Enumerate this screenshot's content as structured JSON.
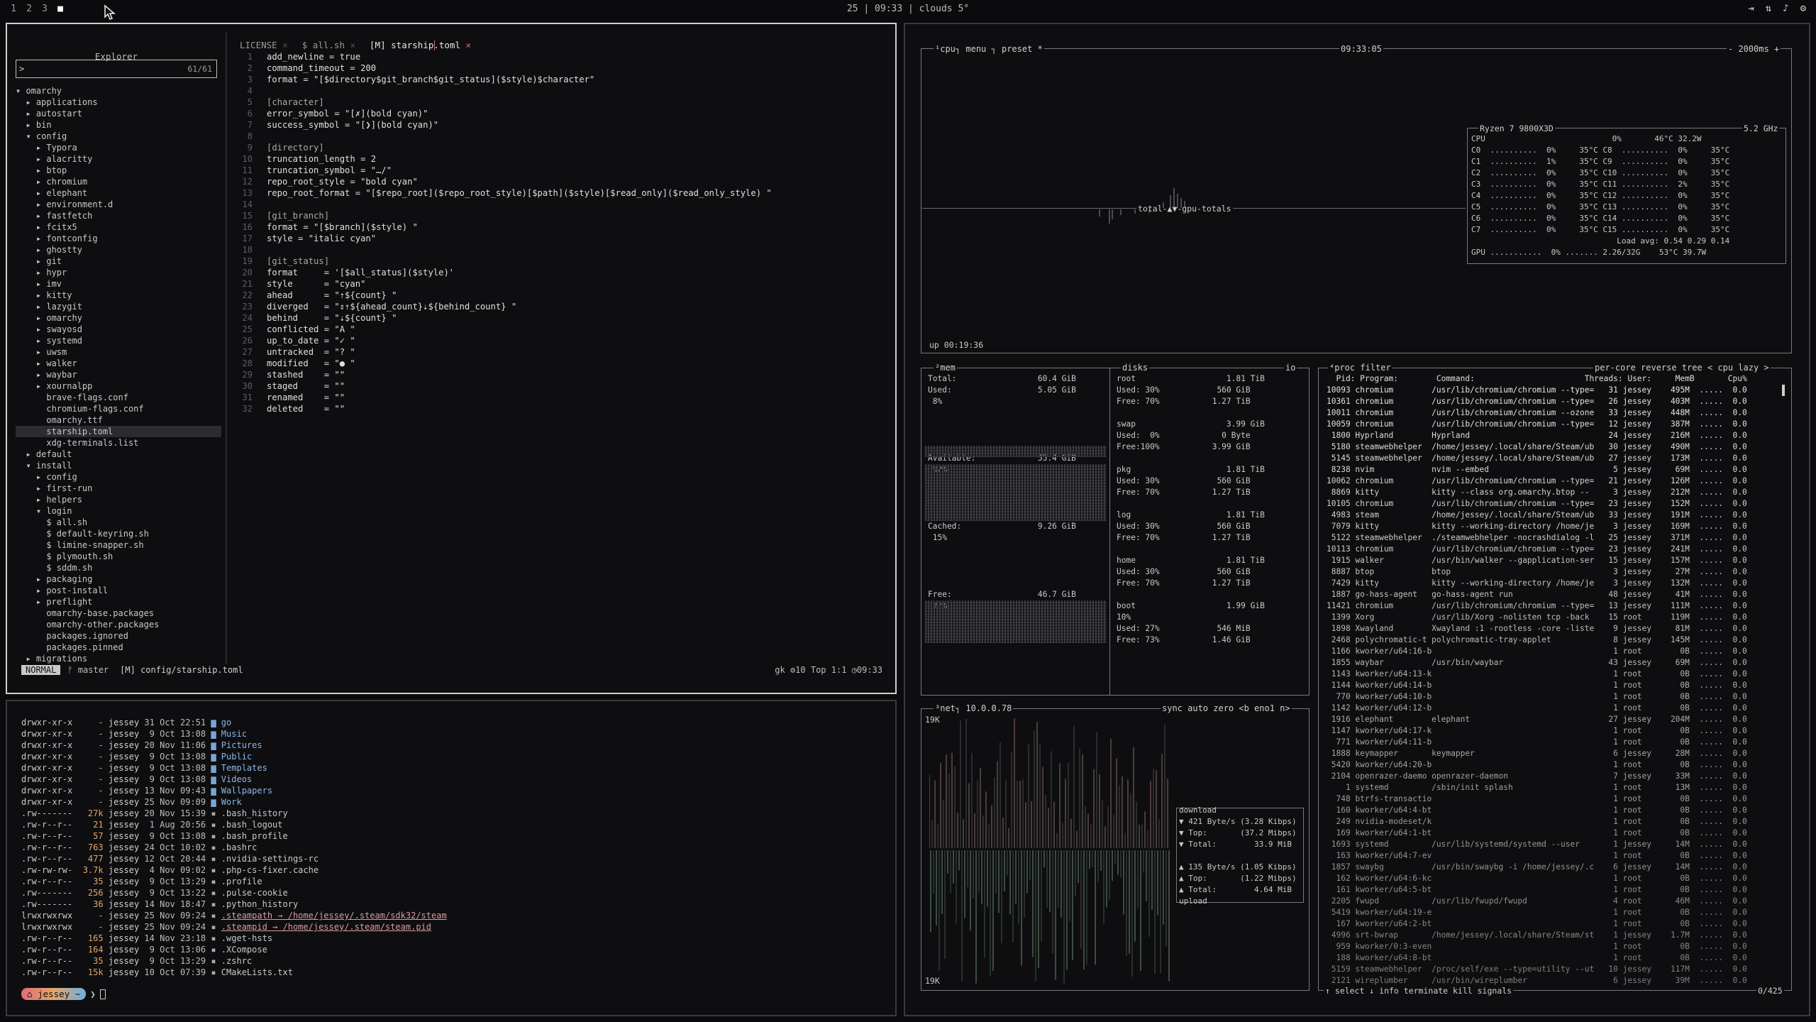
{
  "topbar": {
    "workspaces": [
      "1",
      "2",
      "3",
      "■"
    ],
    "center": "25 | 09:33 | clouds 5°",
    "tray_icons": [
      "logout-icon",
      "network-icon",
      "volume-icon",
      "settings-icon"
    ]
  },
  "explorer": {
    "title": "Explorer",
    "count": "61/61",
    "prompt": ">",
    "tree": [
      "▾ omarchy",
      "  ▸ applications",
      "  ▸ autostart",
      "  ▸ bin",
      "  ▾ config",
      "    ▸ Typora",
      "    ▸ alacritty",
      "    ▸ btop",
      "    ▸ chromium",
      "    ▸ elephant",
      "    ▸ environment.d",
      "    ▸ fastfetch",
      "    ▸ fcitx5",
      "    ▸ fontconfig",
      "    ▸ ghostty",
      "    ▸ git",
      "    ▸ hypr",
      "    ▸ imv",
      "    ▸ kitty",
      "    ▸ lazygit",
      "    ▸ omarchy",
      "    ▸ swayosd",
      "    ▸ systemd",
      "    ▸ uwsm",
      "    ▸ walker",
      "    ▸ waybar",
      "    ▸ xournalpp",
      "      brave-flags.conf",
      "      chromium-flags.conf",
      "      omarchy.ttf",
      "      starship.toml",
      "      xdg-terminals.list",
      "  ▸ default",
      "  ▾ install",
      "    ▸ config",
      "    ▸ first-run",
      "    ▸ helpers",
      "    ▾ login",
      "      $ all.sh",
      "      $ default-keyring.sh",
      "      $ limine-snapper.sh",
      "      $ plymouth.sh",
      "      $ sddm.sh",
      "    ▸ packaging",
      "    ▸ post-install",
      "    ▸ preflight",
      "      omarchy-base.packages",
      "      omarchy-other.packages",
      "      packages.ignored",
      "      packages.pinned",
      "  ▸ migrations"
    ],
    "selected_index": 30
  },
  "editor": {
    "tabs": [
      "LICENSE",
      "$ all.sh",
      "starship.toml"
    ],
    "lines": [
      "add_newline = true",
      "command_timeout = 200",
      "format = \"[$directory$git_branch$git_status]($style)$character\"",
      "",
      "[character]",
      "error_symbol = \"[✗](bold cyan)\"",
      "success_symbol = \"[❯](bold cyan)\"",
      "",
      "[directory]",
      "truncation_length = 2",
      "truncation_symbol = \"…/\"",
      "repo_root_style = \"bold cyan\"",
      "repo_root_format = \"[$repo_root]($repo_root_style)[$path]($style)[$read_only]($read_only_style) \"",
      "",
      "[git_branch]",
      "format = \"[$branch]($style) \"",
      "style = \"italic cyan\"",
      "",
      "[git_status]",
      "format     = '[$all_status]($style)'",
      "style      = \"cyan\"",
      "ahead      = \"⇡${count} \"",
      "diverged   = \"⇕⇡${ahead_count}⇣${behind_count} \"",
      "behind     = \"⇣${count} \"",
      "conflicted = \"A \"",
      "up_to_date = \"✓ \"",
      "untracked  = \"? \"",
      "modified   = \"● \"",
      "stashed    = \"\"",
      "staged     = \"\"",
      "renamed    = \"\"",
      "deleted    = \"\""
    ],
    "status": {
      "mode": "NORMAL",
      "branch": "master",
      "file": "config/starship.toml",
      "right": "gk  ⚙10   Top   1:1   ◷09:33"
    }
  },
  "terminal": {
    "rows": [
      [
        "drwxr-xr-x",
        "-",
        "jessey",
        "31 Oct 22:51",
        "go"
      ],
      [
        "drwxr-xr-x",
        "-",
        "jessey",
        " 9 Oct 13:08",
        "Music"
      ],
      [
        "drwxr-xr-x",
        "-",
        "jessey",
        "20 Nov 11:06",
        "Pictures"
      ],
      [
        "drwxr-xr-x",
        "-",
        "jessey",
        " 9 Oct 13:08",
        "Public"
      ],
      [
        "drwxr-xr-x",
        "-",
        "jessey",
        " 9 Oct 13:08",
        "Templates"
      ],
      [
        "drwxr-xr-x",
        "-",
        "jessey",
        " 9 Oct 13:08",
        "Videos"
      ],
      [
        "drwxr-xr-x",
        "-",
        "jessey",
        "13 Nov 09:43",
        "Wallpapers"
      ],
      [
        "drwxr-xr-x",
        "-",
        "jessey",
        "25 Nov 09:09",
        "Work"
      ],
      [
        ".rw-------",
        "27k",
        "jessey",
        "20 Nov 15:39",
        ".bash_history"
      ],
      [
        ".rw-r--r--",
        "21",
        "jessey",
        " 1 Aug 20:56",
        ".bash_logout"
      ],
      [
        ".rw-r--r--",
        "57",
        "jessey",
        " 9 Oct 13:08",
        ".bash_profile"
      ],
      [
        ".rw-r--r--",
        "763",
        "jessey",
        "24 Oct 10:02",
        ".bashrc"
      ],
      [
        ".rw-r--r--",
        "477",
        "jessey",
        "12 Oct 20:44",
        ".nvidia-settings-rc"
      ],
      [
        ".rw-rw-rw-",
        "3.7k",
        "jessey",
        " 4 Nov 09:02",
        ".php-cs-fixer.cache"
      ],
      [
        ".rw-r--r--",
        "35",
        "jessey",
        " 9 Oct 13:29",
        ".profile"
      ],
      [
        ".rw-------",
        "256",
        "jessey",
        " 9 Oct 13:22",
        ".pulse-cookie"
      ],
      [
        ".rw-------",
        "36",
        "jessey",
        "14 Nov 18:47",
        ".python_history"
      ],
      [
        "lrwxrwxrwx",
        "-",
        "jessey",
        "25 Nov 09:24",
        ".steampath → /home/jessey/.steam/sdk32/steam"
      ],
      [
        "lrwxrwxrwx",
        "-",
        "jessey",
        "25 Nov 09:24",
        ".steampid → /home/jessey/.steam/steam.pid"
      ],
      [
        ".rw-r--r--",
        "165",
        "jessey",
        "14 Nov 23:18",
        ".wget-hsts"
      ],
      [
        ".rw-r--r--",
        "164",
        "jessey",
        " 9 Oct 13:06",
        ".XCompose"
      ],
      [
        ".rw-r--r--",
        "35",
        "jessey",
        " 9 Oct 13:29",
        ".zshrc"
      ],
      [
        ".rw-r--r--",
        "15k",
        "jessey",
        "10 Oct 07:39",
        "CMakeLists.txt"
      ]
    ],
    "prompt_user": "jessey",
    "prompt_symbol": "❯"
  },
  "btop": {
    "cpu_header": [
      "cpu",
      "menu",
      "preset *",
      "09:33:05",
      "- 2000ms +"
    ],
    "graph_label": "total-▲▼-gpu-totals",
    "uptime": "up 00:19:36",
    "cpu_box": {
      "model": "Ryzen 7 9800X3D",
      "freq": "5.2 GHz",
      "cpu_row": "CPU                           0%       46°C 32.2W",
      "cores": [
        "C0  ..........  0%     35°C C8  ..........  0%     35°C",
        "C1  ..........  1%     35°C C9  ..........  0%     35°C",
        "C2  ..........  0%     35°C C10 ..........  0%     35°C",
        "C3  ..........  0%     35°C C11 ..........  2%     35°C",
        "C4  ..........  0%     35°C C12 ..........  0%     35°C",
        "C5  ..........  0%     35°C C13 ..........  0%     35°C",
        "C6  ..........  0%     35°C C14 ..........  0%     35°C",
        "C7  ..........  0%     35°C C15 ..........  0%     35°C"
      ],
      "load": "Load avg: 0.54 0.29 0.14",
      "gpu_row": "GPU ...........  0% ....... 2.26/32G    53°C 39.7W"
    },
    "mem": {
      "title": "mem",
      "lines": [
        "Total:                 60.4 GiB",
        "Used:                  5.05 GiB",
        " 8%",
        "",
        "",
        "",
        "",
        "Available:             55.4 GiB",
        " 92%",
        "",
        "",
        "",
        "",
        "Cached:                9.26 GiB",
        " 15%",
        "",
        "",
        "",
        "",
        "Free:                  46.7 GiB",
        " 77%"
      ]
    },
    "disks": {
      "title": "disks",
      "io": "io",
      "lines": [
        "root                   1.81 TiB",
        "Used: 30%            560 GiB",
        "Free: 70%           1.27 TiB",
        "",
        "swap                   3.99 GiB",
        "Used:  0%             0 Byte",
        "Free:100%           3.99 GiB",
        "",
        "pkg                    1.81 TiB",
        "Used: 30%            560 GiB",
        "Free: 70%           1.27 TiB",
        "",
        "log                    1.81 TiB",
        "Used: 30%            560 GiB",
        "Free: 70%           1.27 TiB",
        "",
        "home                   1.81 TiB",
        "Used: 30%            560 GiB",
        "Free: 70%           1.27 TiB",
        "",
        "boot                   1.99 GiB",
        "10%",
        "Used: 27%            546 MiB",
        "Free: 73%           1.46 GiB"
      ]
    },
    "net": {
      "title": "net",
      "ip": "10.0.0.78",
      "controls": "sync auto zero <b eno1 n>",
      "top_scale": "19K",
      "bottom_scale": "19K",
      "lines": [
        "download",
        "▼ 421 Byte/s (3.28 Kibps)",
        "▼ Top:       (37.2 Mibps)",
        "▼ Total:        33.9 MiB",
        "",
        "▲ 135 Byte/s (1.05 Kibps)",
        "▲ Top:       (1.22 Mibps)",
        "▲ Total:        4.64 MiB",
        "upload"
      ]
    },
    "proc": {
      "header_left": "proc  filter",
      "header_right": "per-core  reverse  tree  < cpu lazy >",
      "columns": "  Pid: Program:        Command:                       Threads: User:     MemB       Cpu%",
      "rows": [
        "10093 chromium        /usr/lib/chromium/chromium --type=   31 jessey    495M  .....  0.0",
        "10361 chromium        /usr/lib/chromium/chromium --type=   26 jessey    403M  .....  0.0",
        "10011 chromium        /usr/lib/chromium/chromium --ozone   33 jessey    448M  .....  0.0",
        "10059 chromium        /usr/lib/chromium/chromium --type=   12 jessey    387M  .....  0.0",
        " 1800 Hyprland        Hyprland                             24 jessey    216M  .....  0.0",
        " 5180 steamwebhelper  /home/jessey/.local/share/Steam/ub   30 jessey    490M  .....  0.0",
        " 5145 steamwebhelper  /home/jessey/.local/share/Steam/ub   27 jessey    173M  .....  0.0",
        " 8238 nvim            nvim --embed                          5 jessey     69M  .....  0.0",
        "10062 chromium        /usr/lib/chromium/chromium --type=   21 jessey    126M  .....  0.0",
        " 8869 kitty           kitty --class org.omarchy.btop --     3 jessey    212M  .....  0.0",
        "10105 chromium        /usr/lib/chromium/chromium --type=   23 jessey    152M  .....  0.0",
        " 4983 steam           /home/jessey/.local/share/Steam/ub   33 jessey    191M  .....  0.0",
        " 7079 kitty           kitty --working-directory /home/je    3 jessey    169M  .....  0.0",
        " 5122 steamwebhelper  ./steamwebhelper -nocrashdialog -l   25 jessey    371M  .....  0.0",
        "10113 chromium        /usr/lib/chromium/chromium --type=   23 jessey    241M  .....  0.0",
        " 1915 walker          /usr/bin/walker --gapplication-ser   15 jessey    157M  .....  0.0",
        " 8887 btop            btop                                  3 jessey     27M  .....  0.0",
        " 7429 kitty           kitty --working-directory /home/je    3 jessey    132M  .....  0.0",
        " 1887 go-hass-agent   go-hass-agent run                    48 jessey     41M  .....  0.0",
        "11421 chromium        /usr/lib/chromium/chromium --type=   13 jessey    111M  .....  0.0",
        " 1399 Xorg            /usr/lib/Xorg -nolisten tcp -back    15 root      119M  .....  0.0",
        " 1898 Xwayland        Xwayland :1 -rootless -core -liste    9 jessey     81M  .....  0.0",
        " 2468 polychromatic-t polychromatic-tray-applet             8 jessey    145M  .....  0.0",
        " 1166 kworker/u64:16-b                                      1 root        0B  .....  0.0",
        " 1855 waybar          /usr/bin/waybar                      43 jessey     69M  .....  0.0",
        " 1143 kworker/u64:13-k                                      1 root        0B  .....  0.0",
        " 1144 kworker/u64:14-b                                      1 root        0B  .....  0.0",
        "  770 kworker/u64:10-b                                      1 root        0B  .....  0.0",
        " 1142 kworker/u64:12-b                                      1 root        0B  .....  0.0",
        " 1916 elephant        elephant                             27 jessey    204M  .....  0.0",
        " 1147 kworker/u64:17-k                                      1 root        0B  .....  0.0",
        "  771 kworker/u64:11-b                                      1 root        0B  .....  0.0",
        " 1888 keymapper       keymapper                             6 jessey     28M  .....  0.0",
        " 5420 kworker/u64:20-b                                      1 root        0B  .....  0.0",
        " 2104 openrazer-daemo openrazer-daemon                      7 jessey     33M  .....  0.0",
        "    1 systemd         /sbin/init splash                     1 root       13M  .....  0.0",
        "  748 btrfs-transactio                                      1 root        0B  .....  0.0",
        "  160 kworker/u64:4-bt                                      1 root        0B  .....  0.0",
        "  249 nvidia-modeset/k                                      1 root        0B  .....  0.0",
        "  169 kworker/u64:1-bt                                      1 root        0B  .....  0.0",
        " 1693 systemd         /usr/lib/systemd/systemd --user       1 jessey     14M  .....  0.0",
        "  163 kworker/u64:7-ev                                      1 root        0B  .....  0.0",
        " 1857 swaybg          /usr/bin/swaybg -i /home/jessey/.c    6 jessey     14M  .....  0.0",
        "  162 kworker/u64:6-kc                                      1 root        0B  .....  0.0",
        "  161 kworker/u64:5-bt                                      1 root        0B  .....  0.0",
        " 2205 fwupd           /usr/lib/fwupd/fwupd                  4 root       46M  .....  0.0",
        " 5419 kworker/u64:19-e                                      1 root        0B  .....  0.0",
        "  167 kworker/u64:2-bt                                      1 root        0B  .....  0.0",
        " 4996 srt-bwrap       /home/jessey/.local/share/Steam/st    1 jessey    1.7M  .....  0.0",
        "  959 kworker/0:3-even                                      1 root        0B  .....  0.0",
        "  188 kworker/u64:8-bt                                      1 root        0B  .....  0.0",
        " 5159 steamwebhelper  /proc/self/exe --type=utility --ut   10 jessey    117M  .....  0.0",
        " 2121 wireplumber     /usr/bin/wireplumber                  6 jessey     39M  .....  0.0"
      ],
      "footer": "↑ select ↓  info   terminate  kill   signals",
      "count": "0/425"
    }
  }
}
